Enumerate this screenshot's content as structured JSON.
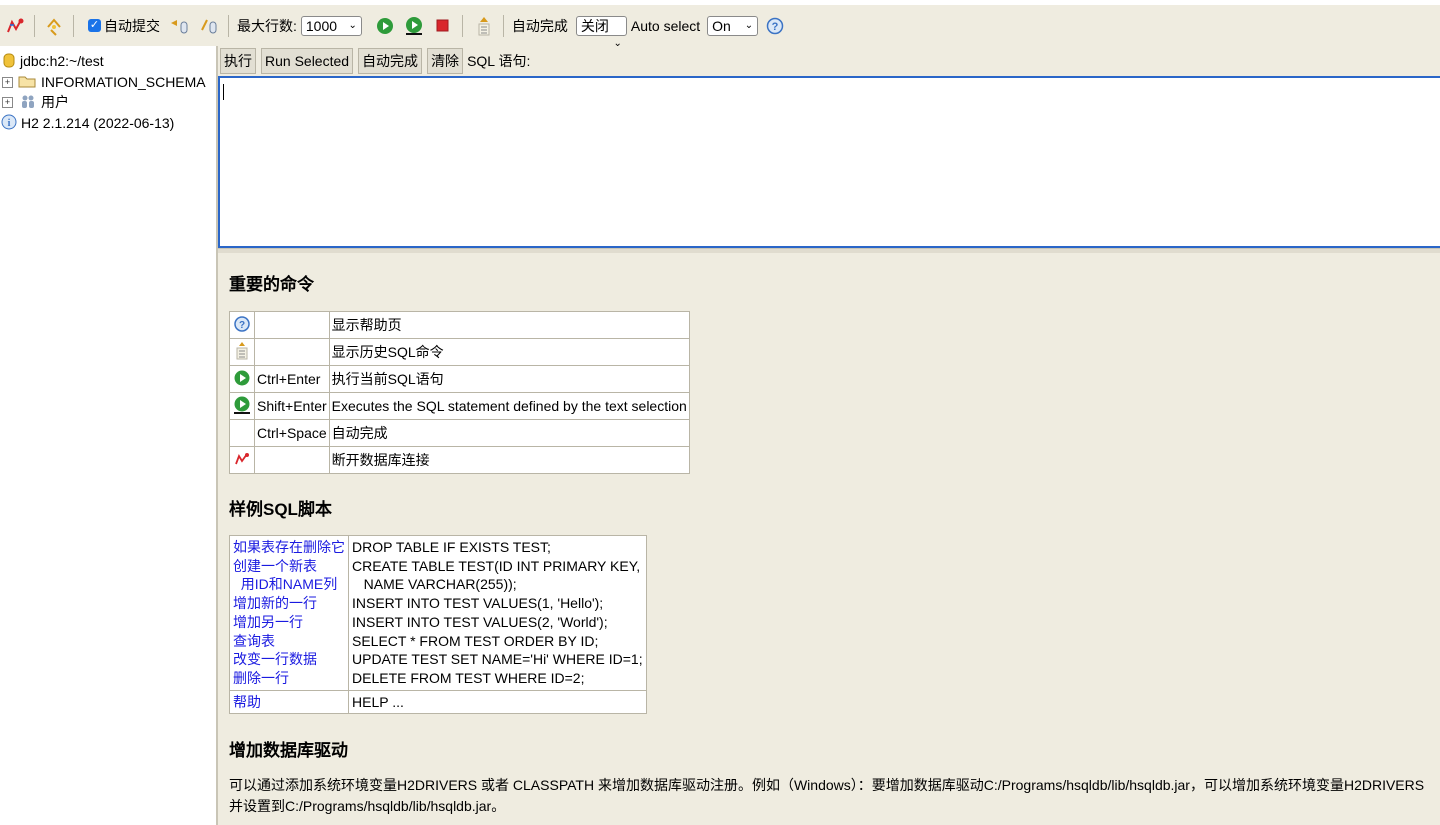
{
  "toolbar": {
    "autocommit_label": "自动提交",
    "max_rows_label": "最大行数:",
    "max_rows_value": "1000",
    "autocomplete_label": "自动完成",
    "autocomplete_value": "关闭",
    "auto_select_label": "Auto select",
    "auto_select_value": "On"
  },
  "tree": {
    "connection": "jdbc:h2:~/test",
    "schema": "INFORMATION_SCHEMA",
    "users": "用户",
    "version": "H2 2.1.214 (2022-06-13)"
  },
  "sqlbar": {
    "execute": "执行",
    "run_selected": "Run Selected",
    "autocomplete": "自动完成",
    "clear": "清除",
    "sql_label": "SQL 语句:"
  },
  "editor": {
    "value": ""
  },
  "help": {
    "title": "重要的命令",
    "rows": [
      {
        "icon": "help-icon",
        "key": "",
        "desc": "显示帮助页"
      },
      {
        "icon": "history-icon",
        "key": "",
        "desc": "显示历史SQL命令"
      },
      {
        "icon": "run-icon",
        "key": "Ctrl+Enter",
        "desc": "执行当前SQL语句"
      },
      {
        "icon": "run-selected-icon",
        "key": "Shift+Enter",
        "desc": "Executes the SQL statement defined by the text selection"
      },
      {
        "icon": "",
        "key": "Ctrl+Space",
        "desc": "自动完成"
      },
      {
        "icon": "disconnect-icon",
        "key": "",
        "desc": "断开数据库连接"
      }
    ]
  },
  "samples": {
    "title": "样例SQL脚本",
    "links": [
      "如果表存在删除它",
      "创建一个新表",
      "  用ID和NAME列",
      "增加新的一行",
      "增加另一行",
      "查询表",
      "改变一行数据",
      "删除一行"
    ],
    "code": [
      "DROP TABLE IF EXISTS TEST;",
      "CREATE TABLE TEST(ID INT PRIMARY KEY,",
      "   NAME VARCHAR(255));",
      "INSERT INTO TEST VALUES(1, 'Hello');",
      "INSERT INTO TEST VALUES(2, 'World');",
      "SELECT * FROM TEST ORDER BY ID;",
      "UPDATE TEST SET NAME='Hi' WHERE ID=1;",
      "DELETE FROM TEST WHERE ID=2;"
    ],
    "help_link": "帮助",
    "help_code": "HELP ..."
  },
  "drivers": {
    "title": "增加数据库驱动",
    "text": "可以通过添加系统环境变量H2DRIVERS 或者 CLASSPATH 来增加数据库驱动注册。例如（Windows）：要增加数据库驱动C:/Programs/hsqldb/lib/hsqldb.jar，可以增加系统环境变量H2DRIVERS并设置到C:/Programs/hsqldb/lib/hsqldb.jar。"
  },
  "colors": {
    "accent": "#1a73e8",
    "run_green": "#2e9b3a",
    "stop_red": "#d9262c",
    "link_blue": "#1a1ae0",
    "panel_bg": "#efece0"
  }
}
